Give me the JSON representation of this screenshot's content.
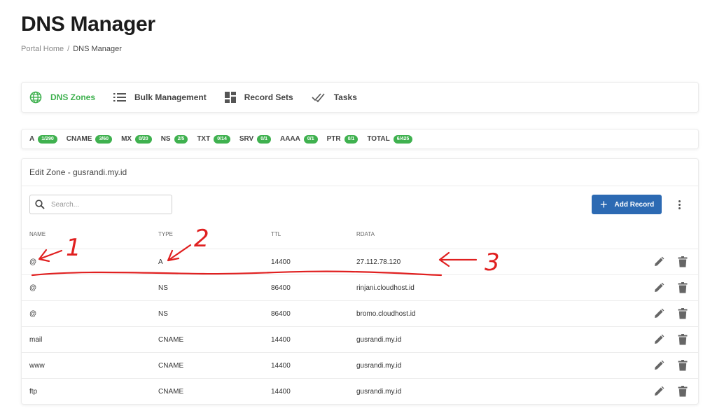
{
  "page": {
    "title": "DNS Manager"
  },
  "breadcrumb": {
    "home": "Portal Home",
    "separator": "/",
    "current": "DNS Manager"
  },
  "tabs": [
    {
      "label": "DNS Zones",
      "icon": "globe-icon",
      "active": true
    },
    {
      "label": "Bulk Management",
      "icon": "list-icon",
      "active": false
    },
    {
      "label": "Record Sets",
      "icon": "grid-icon",
      "active": false
    },
    {
      "label": "Tasks",
      "icon": "check-double-icon",
      "active": false
    }
  ],
  "record_counts": [
    {
      "type": "A",
      "count": "1/290"
    },
    {
      "type": "CNAME",
      "count": "3/60"
    },
    {
      "type": "MX",
      "count": "0/20"
    },
    {
      "type": "NS",
      "count": "2/5"
    },
    {
      "type": "TXT",
      "count": "0/14"
    },
    {
      "type": "SRV",
      "count": "0/1"
    },
    {
      "type": "AAAA",
      "count": "0/1"
    },
    {
      "type": "PTR",
      "count": "0/1"
    },
    {
      "type": "TOTAL",
      "count": "6/425"
    }
  ],
  "zone": {
    "title": "Edit Zone - gusrandi.my.id",
    "search_placeholder": "Search...",
    "search_value": "",
    "add_button": "Add Record",
    "columns": {
      "name": "NAME",
      "type": "TYPE",
      "ttl": "TTL",
      "rdata": "RDATA"
    },
    "records": [
      {
        "name": "@",
        "type": "A",
        "ttl": "14400",
        "rdata": "27.112.78.120"
      },
      {
        "name": "@",
        "type": "NS",
        "ttl": "86400",
        "rdata": "rinjani.cloudhost.id"
      },
      {
        "name": "@",
        "type": "NS",
        "ttl": "86400",
        "rdata": "bromo.cloudhost.id"
      },
      {
        "name": "mail",
        "type": "CNAME",
        "ttl": "14400",
        "rdata": "gusrandi.my.id"
      },
      {
        "name": "www",
        "type": "CNAME",
        "ttl": "14400",
        "rdata": "gusrandi.my.id"
      },
      {
        "name": "ftp",
        "type": "CNAME",
        "ttl": "14400",
        "rdata": "gusrandi.my.id"
      }
    ]
  },
  "colors": {
    "accent": "#3fb14f",
    "primary_button": "#2c6ab3",
    "annotation": "#e02020",
    "icon_gray": "#666666"
  },
  "annotations": [
    {
      "label": "1"
    },
    {
      "label": "2"
    },
    {
      "label": "3"
    }
  ]
}
